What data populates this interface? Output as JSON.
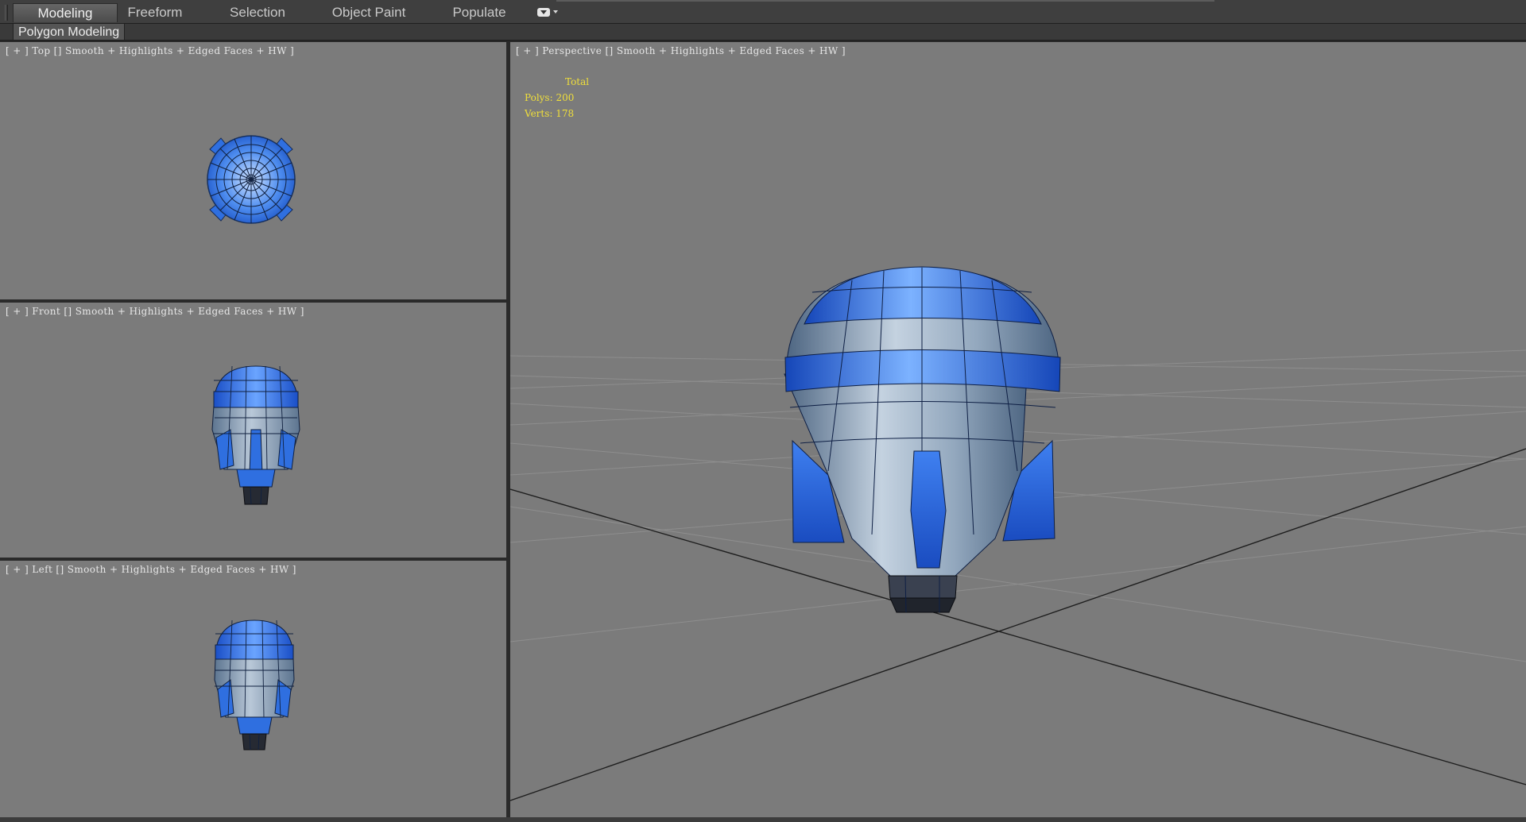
{
  "ribbon": {
    "tabs": [
      {
        "label": "Modeling",
        "active": true
      },
      {
        "label": "Freeform",
        "active": false
      },
      {
        "label": "Selection",
        "active": false
      },
      {
        "label": "Object Paint",
        "active": false
      },
      {
        "label": "Populate",
        "active": false
      }
    ],
    "options_icon": "dropdown-pill-icon",
    "panel_label": "Polygon Modeling"
  },
  "viewports": {
    "top": {
      "label": "[ + ] Top [] Smooth + Highlights + Edged Faces + HW ]"
    },
    "front": {
      "label": "[ + ] Front [] Smooth + Highlights + Edged Faces + HW ]"
    },
    "left": {
      "label": "[ + ] Left [] Smooth + Highlights + Edged Faces + HW ]"
    },
    "perspective": {
      "label": "[ + ] Perspective [] Smooth + Highlights + Edged Faces + HW ]",
      "stats": {
        "total_label": "Total",
        "polys": "Polys: 200",
        "verts": "Verts: 178"
      }
    }
  },
  "colors": {
    "viewport_bg": "#7b7b7b",
    "model_blue": "#2f6fe0",
    "model_gray": "#8ea3b8",
    "stats_text": "#f0df3a"
  }
}
